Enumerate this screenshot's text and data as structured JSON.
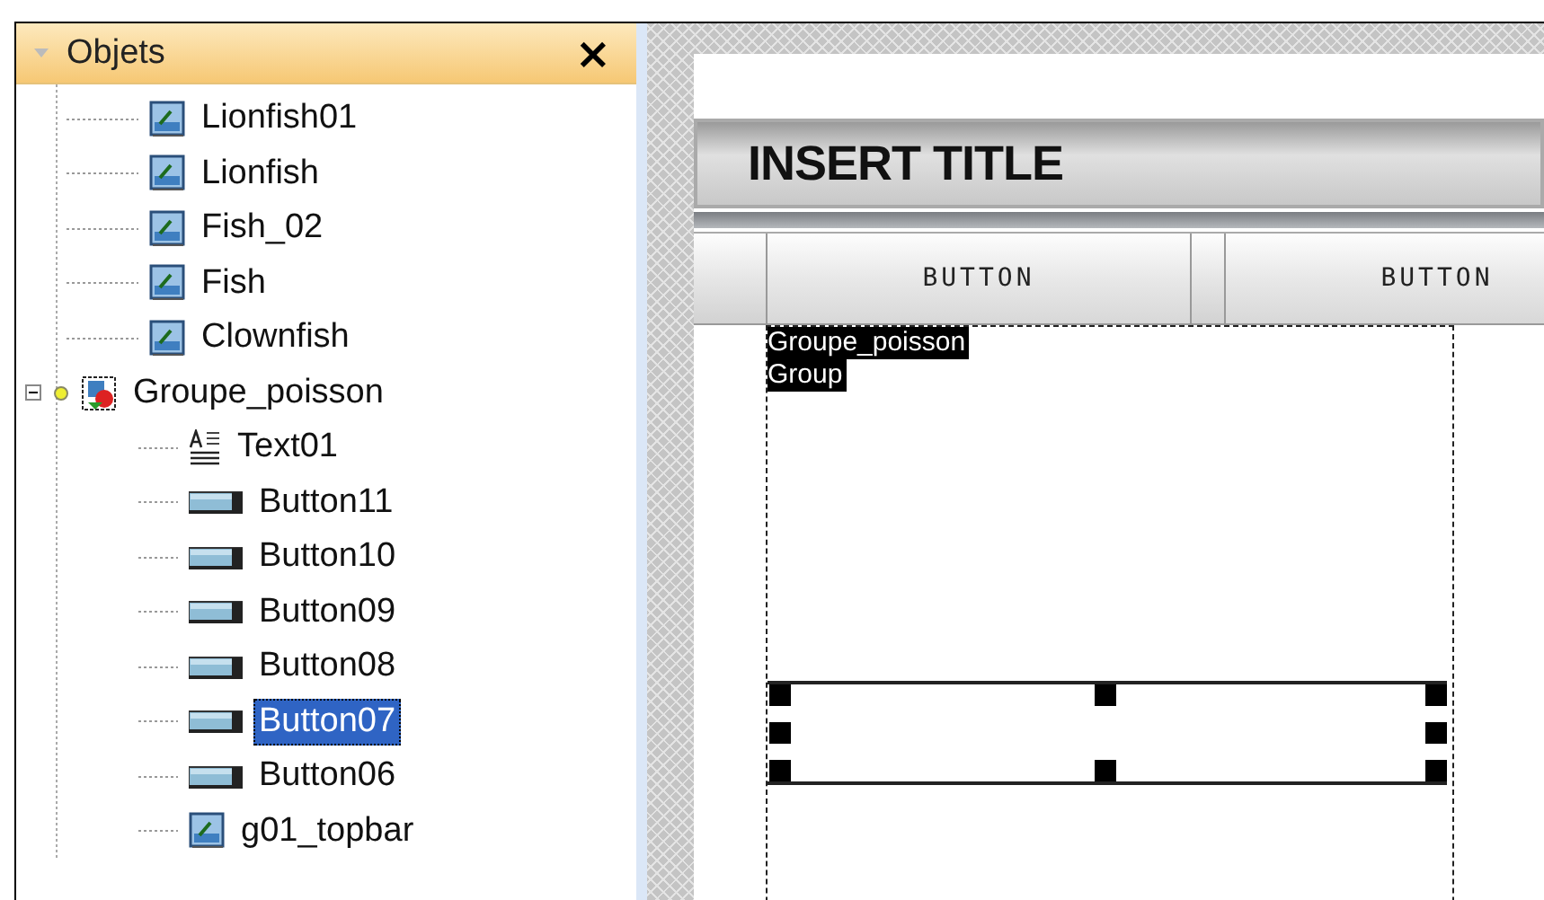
{
  "panel": {
    "title": "Objets",
    "close": "×"
  },
  "tree": [
    {
      "label": "Lionfish01",
      "kind": "image",
      "selected": false
    },
    {
      "label": "Lionfish",
      "kind": "image",
      "selected": false
    },
    {
      "label": "Fish_02",
      "kind": "image",
      "selected": false
    },
    {
      "label": "Fish",
      "kind": "image",
      "selected": false
    },
    {
      "label": "Clownfish",
      "kind": "image",
      "selected": false
    },
    {
      "label": "Groupe_poisson",
      "kind": "group",
      "selected": false,
      "expanded": true,
      "children": [
        {
          "label": "Text01",
          "kind": "text",
          "selected": false
        },
        {
          "label": "Button11",
          "kind": "button",
          "selected": false
        },
        {
          "label": "Button10",
          "kind": "button",
          "selected": false
        },
        {
          "label": "Button09",
          "kind": "button",
          "selected": false
        },
        {
          "label": "Button08",
          "kind": "button",
          "selected": false
        },
        {
          "label": "Button07",
          "kind": "button",
          "selected": true
        },
        {
          "label": "Button06",
          "kind": "button",
          "selected": false
        },
        {
          "label": "g01_topbar",
          "kind": "image",
          "selected": false
        }
      ]
    }
  ],
  "canvas": {
    "title": "INSERT TITLE",
    "buttons": [
      "BUTTON",
      "BUTTON"
    ],
    "group_label": [
      "Groupe_poisson",
      "Group"
    ]
  }
}
